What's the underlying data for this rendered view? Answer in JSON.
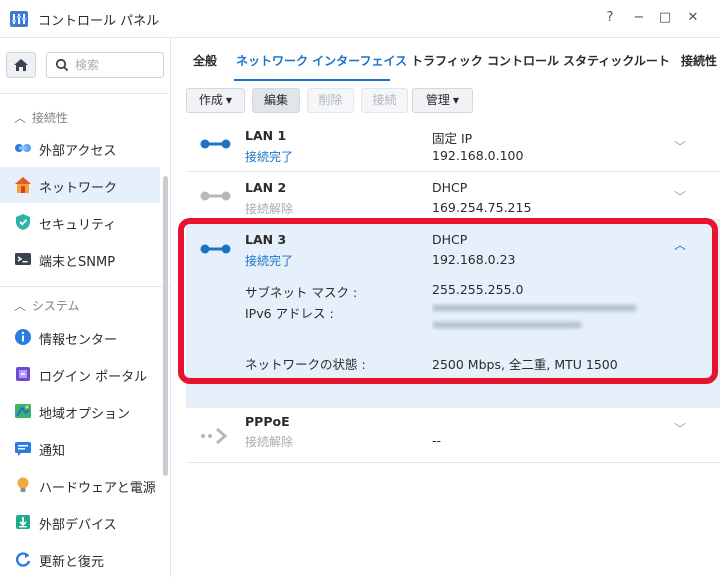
{
  "window": {
    "title": "コントロール パネル",
    "help": "?",
    "minimize": "−",
    "maximize": "□",
    "close": "✕"
  },
  "sidebar": {
    "search_placeholder": "検索",
    "groups": [
      {
        "label": "接続性"
      },
      {
        "label": "システム"
      }
    ],
    "items": [
      {
        "label": "外部アクセス",
        "icon": "external-access-icon"
      },
      {
        "label": "ネットワーク",
        "icon": "network-icon"
      },
      {
        "label": "セキュリティ",
        "icon": "security-shield-icon"
      },
      {
        "label": "端末とSNMP",
        "icon": "terminal-icon"
      },
      {
        "label": "情報センター",
        "icon": "info-icon"
      },
      {
        "label": "ログイン ポータル",
        "icon": "login-portal-icon"
      },
      {
        "label": "地域オプション",
        "icon": "regional-options-icon"
      },
      {
        "label": "通知",
        "icon": "notification-icon"
      },
      {
        "label": "ハードウェアと電源",
        "icon": "hardware-power-icon"
      },
      {
        "label": "外部デバイス",
        "icon": "external-device-icon"
      },
      {
        "label": "更新と復元",
        "icon": "update-restore-icon"
      }
    ]
  },
  "tabs": [
    {
      "label": "全般"
    },
    {
      "label": "ネットワーク インターフェイス"
    },
    {
      "label": "トラフィック コントロール"
    },
    {
      "label": "スタティックルート"
    },
    {
      "label": "接続性"
    }
  ],
  "toolbar": {
    "create": "作成",
    "edit": "編集",
    "delete": "削除",
    "connect": "接続",
    "manage": "管理"
  },
  "interfaces": [
    {
      "name": "LAN 1",
      "status": "接続完了",
      "mode": "固定 IP",
      "ip": "192.168.0.100"
    },
    {
      "name": "LAN 2",
      "status": "接続解除",
      "mode": "DHCP",
      "ip": "169.254.75.215"
    },
    {
      "name": "LAN 3",
      "status": "接続完了",
      "mode": "DHCP",
      "ip": "192.168.0.23",
      "details": {
        "subnet_label": "サブネット マスク :",
        "subnet_value": "255.255.255.0",
        "ipv6_label": "IPv6 アドレス :",
        "network_status_label": "ネットワークの状態 :",
        "network_status_value": "2500 Mbps, 全二重, MTU 1500"
      }
    },
    {
      "name": "PPPoE",
      "status": "接続解除",
      "mode": "",
      "ip": "--"
    }
  ],
  "colors": {
    "accent": "#1a73c9",
    "highlight": "#e8142f",
    "selected_row": "#e6f0fb"
  }
}
